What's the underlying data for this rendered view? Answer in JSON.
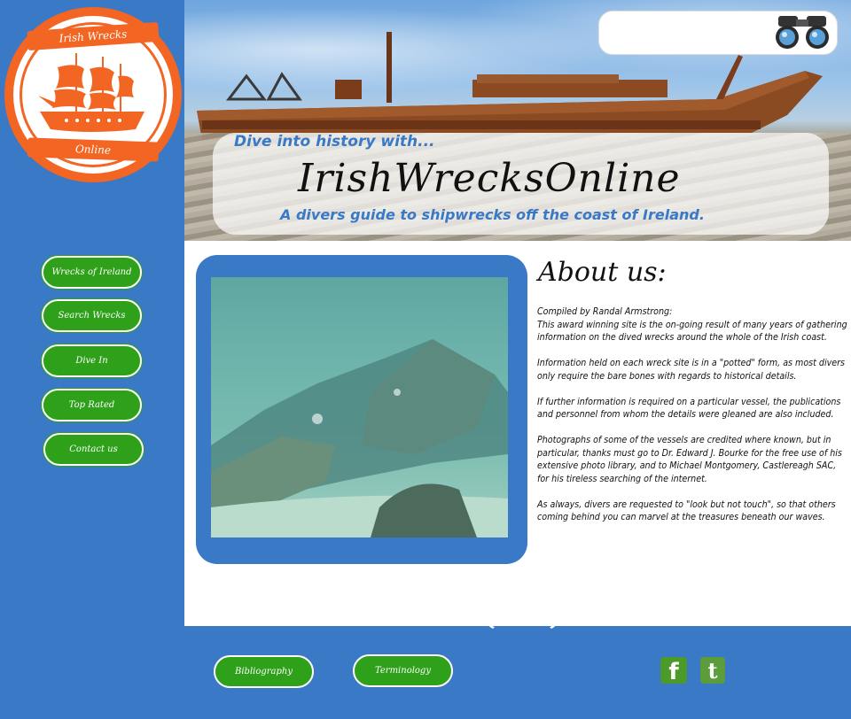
{
  "logo": {
    "top_text": "Irish Wrecks",
    "bottom_text": "Online",
    "icon": "sailing-ship-icon"
  },
  "nav": [
    {
      "label": "Wrecks of Ireland"
    },
    {
      "label": "Search Wrecks"
    },
    {
      "label": "Dive In"
    },
    {
      "label": "Top Rated"
    },
    {
      "label": "Contact us"
    }
  ],
  "header": {
    "tagline_top": "Dive into history with...",
    "title": "IrishWrecksOnline",
    "tagline_bottom": "A divers guide to shipwrecks off the coast of Ireland.",
    "search_icon": "binoculars-icon"
  },
  "about": {
    "title": "About us:",
    "paragraphs": [
      "Compiled by Randal Armstrong:\nThis award winning site is the on-going result of many years of gathering information on the dived wrecks around the whole of the Irish coast.",
      "Information held on each wreck site is in a \"potted\" form, as most divers only require the bare bones with regards to historical details.",
      "If further information is required on a particular vessel, the publications and personnel from whom the details were gleaned are also included.",
      "Photographs of some of the vessels are credited where known, but in particular, thanks must go to Dr. Edward J. Bourke for the free use of his extensive photo library, and to Michael Montgomery, Castlereagh SAC, for his tireless searching of the internet.",
      "As always, divers are requested to \"look but not touch\", so that others coming behind you can marvel at the treasures beneath our waves."
    ]
  },
  "footer": {
    "bibliography": "Bibliography",
    "terminology": "Terminology",
    "facebook_icon": "facebook-icon",
    "twitter_icon": "twitter-icon"
  },
  "colors": {
    "brand_blue": "#3a79c6",
    "button_green": "#2ea01a",
    "logo_orange": "#f26522"
  }
}
